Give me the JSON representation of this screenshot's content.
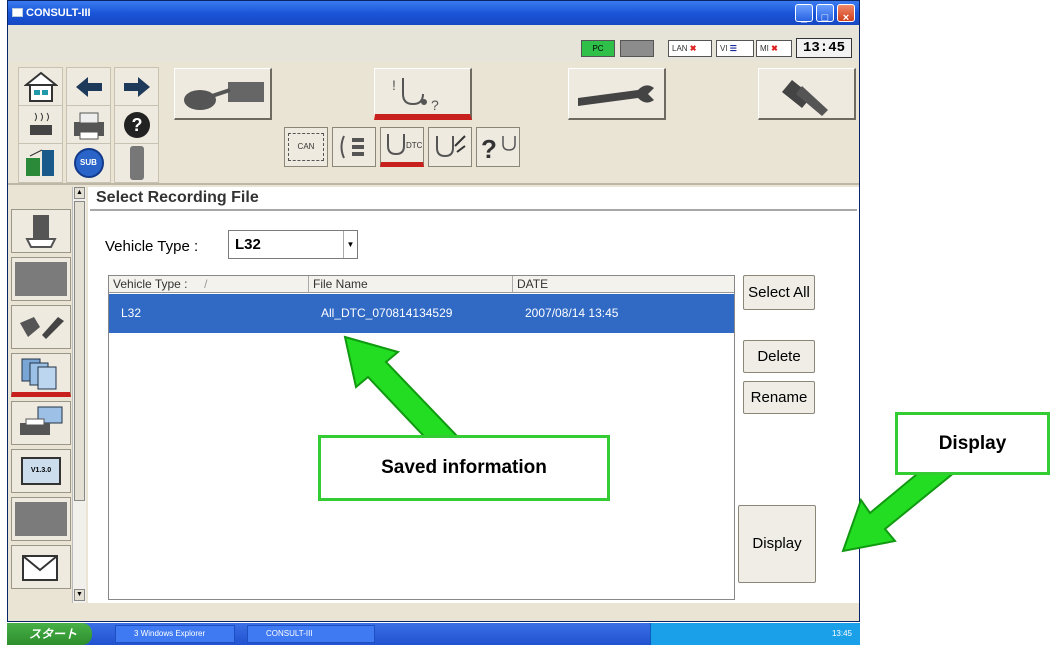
{
  "window": {
    "title": "CONSULT-III",
    "status": {
      "pc_label": "PC",
      "lan_label": "LAN",
      "vi_label": "VI",
      "mi_label": "MI",
      "clock": "13:45"
    }
  },
  "toolbar": {
    "nav_icons": [
      "home-icon",
      "back-arrow-icon",
      "forward-arrow-icon",
      "heater-icon",
      "printer-icon",
      "help-icon",
      "screen-capture-icon",
      "sub-icon",
      "mode-bar-icon"
    ],
    "sub_label": "SUB",
    "main_modes": [
      "vehicle-connect-icon",
      "diagnosis-icon",
      "wrench-icon",
      "repair-icon"
    ],
    "sub_modes": {
      "can_label": "CAN",
      "dtc_label": "DTC"
    }
  },
  "leftnav": {
    "version_label": "V1.3.0"
  },
  "content": {
    "title": "Select Recording File",
    "vehicle_type_label": "Vehicle Type :",
    "vehicle_type_value": "L32",
    "table": {
      "columns": [
        "Vehicle Type :",
        "File Name",
        "DATE"
      ],
      "rows": [
        {
          "vehicle_type": "L32",
          "file_name": "All_DTC_070814134529",
          "date": "2007/08/14 13:45"
        }
      ]
    },
    "buttons": {
      "select_all": "Select All",
      "delete": "Delete",
      "rename": "Rename",
      "display": "Display"
    }
  },
  "callouts": {
    "saved_information": "Saved information",
    "display": "Display"
  },
  "taskbar": {
    "start_label": "スタート",
    "task1": "3 Windows Explorer",
    "task2": "CONSULT-III",
    "tray_time": "13:45"
  },
  "colors": {
    "accent_selected_row": "#316ac5",
    "active_indicator": "#c8201c",
    "callout_green": "#33cc33"
  }
}
